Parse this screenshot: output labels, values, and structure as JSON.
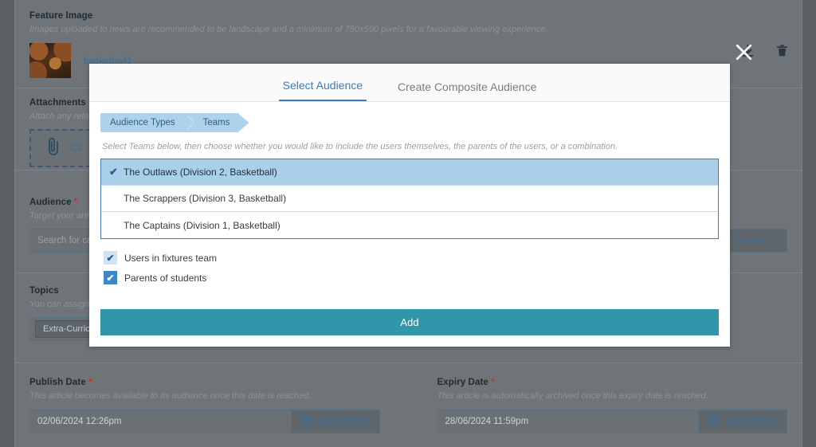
{
  "background_form": {
    "feature_image": {
      "label": "Feature Image",
      "help": "Images uploaded to news are recommended to be landscape and a minimum of 750x500 pixels for a favourable viewing experience.",
      "file_name": "basketball1"
    },
    "attachments": {
      "label": "Attachments",
      "help": "Attach any relat",
      "dropzone_text": "Cli"
    },
    "audience": {
      "label": "Audience",
      "required_marker": "*",
      "help": "Target your artic",
      "search_placeholder": "Search for cam",
      "browse_label": "Browse..."
    },
    "topics": {
      "label": "Topics",
      "help": "You can assign n",
      "chip_label": "Extra-Curricul"
    },
    "publish_date": {
      "label": "Publish Date",
      "required_marker": "*",
      "help": "This article becomes available to its audience once this date is reached.",
      "value": "02/06/2024 12:26pm",
      "button_label": "Select Date"
    },
    "expiry_date": {
      "label": "Expiry Date",
      "required_marker": "*",
      "help": "This article is automatically archived once this expiry date is reached.",
      "value": "28/06/2024 11:59pm",
      "button_label": "Select Date"
    }
  },
  "top_icons": {
    "download": "download-icon",
    "trash": "trash-icon",
    "close": "close-icon"
  },
  "modal": {
    "tabs": [
      {
        "label": "Select Audience",
        "active": true
      },
      {
        "label": "Create Composite Audience",
        "active": false
      }
    ],
    "breadcrumb": [
      {
        "label": "Audience Types"
      },
      {
        "label": "Teams"
      }
    ],
    "instruction": "Select Teams below, then choose whether you would like to include the users themselves, the parents of the users, or a combination.",
    "teams": [
      {
        "label": "The Outlaws (Division 2, Basketball)",
        "selected": true
      },
      {
        "label": "The Scrappers (Division 3, Basketball)",
        "selected": false
      },
      {
        "label": "The Captains (Division 1, Basketball)",
        "selected": false
      }
    ],
    "options": [
      {
        "label": "Users in fixtures team",
        "checked": true,
        "style": "shade-light"
      },
      {
        "label": "Parents of students",
        "checked": true,
        "style": "shade-solid"
      }
    ],
    "add_button": "Add",
    "check_glyph": "✔"
  },
  "colors": {
    "accent_teal": "#2f96ac",
    "accent_blue": "#3d7ab8",
    "selected_row": "#a9cfe9",
    "breadcrumb": "#aed2ea",
    "page_bg": "#595f63",
    "panel_bg": "#6e7478"
  }
}
